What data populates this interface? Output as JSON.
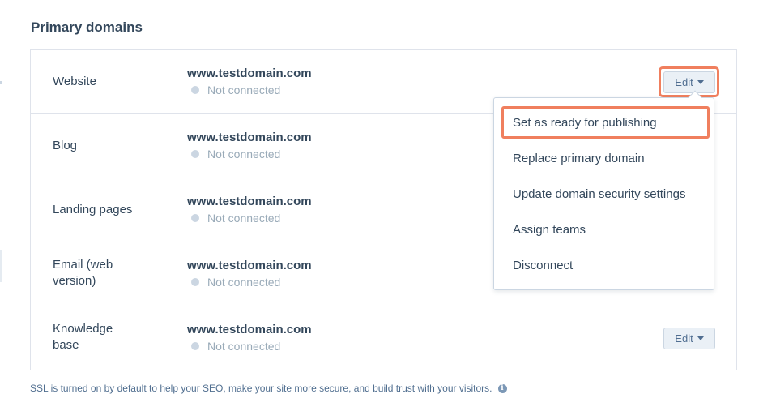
{
  "section": {
    "title": "Primary domains"
  },
  "rows": [
    {
      "label": "Website",
      "domain": "www.testdomain.com",
      "status": "Not connected",
      "edit_label": "Edit"
    },
    {
      "label": "Blog",
      "domain": "www.testdomain.com",
      "status": "Not connected"
    },
    {
      "label": "Landing pages",
      "domain": "www.testdomain.com",
      "status": "Not connected"
    },
    {
      "label": "Email (web version)",
      "domain": "www.testdomain.com",
      "status": "Not connected"
    },
    {
      "label": "Knowledge base",
      "domain": "www.testdomain.com",
      "status": "Not connected",
      "edit_label": "Edit"
    }
  ],
  "dropdown": {
    "items": [
      "Set as ready for publishing",
      "Replace primary domain",
      "Update domain security settings",
      "Assign teams",
      "Disconnect"
    ]
  },
  "footnote": {
    "text": "SSL is turned on by default to help your SEO, make your site more secure, and build trust with your visitors.",
    "icon": "info-icon"
  },
  "colors": {
    "highlight": "#f07f5e",
    "status_dot": "#cbd6e2",
    "text": "#33475b"
  }
}
